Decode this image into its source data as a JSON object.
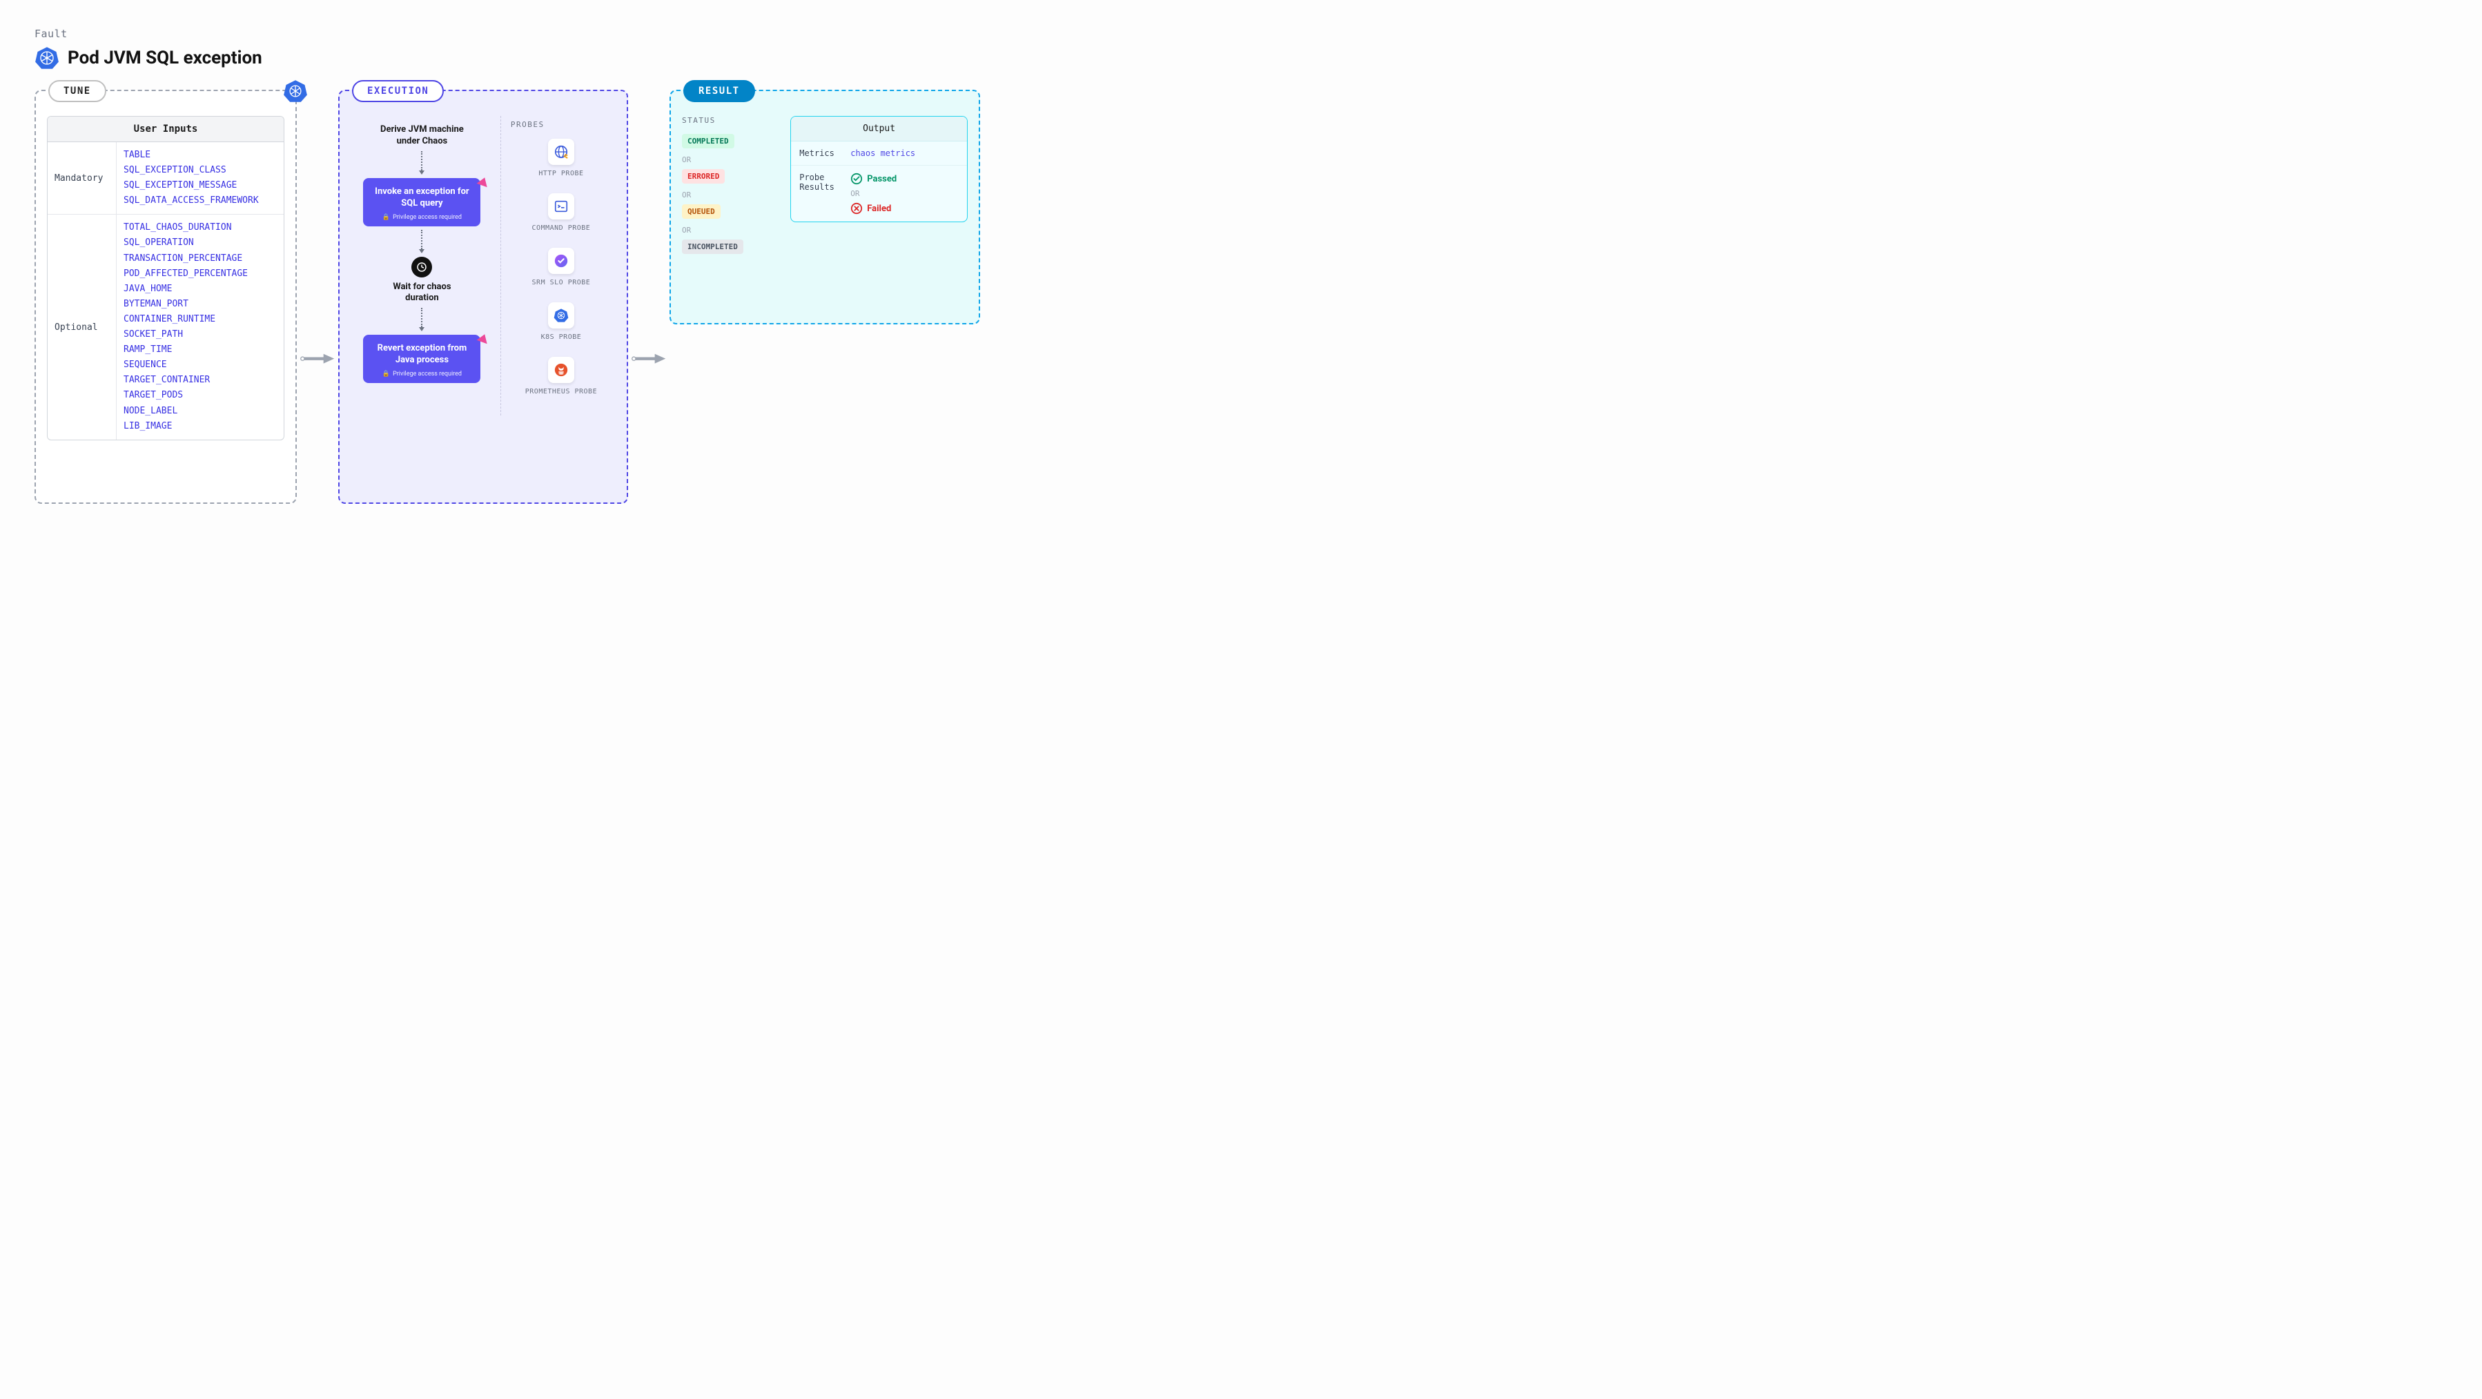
{
  "header": {
    "fault_label": "Fault",
    "title": "Pod JVM SQL exception"
  },
  "tune": {
    "pill": "TUNE",
    "card_title": "User Inputs",
    "mandatory_label": "Mandatory",
    "optional_label": "Optional",
    "mandatory": [
      "TABLE",
      "SQL_EXCEPTION_CLASS",
      "SQL_EXCEPTION_MESSAGE",
      "SQL_DATA_ACCESS_FRAMEWORK"
    ],
    "optional": [
      "TOTAL_CHAOS_DURATION",
      "SQL_OPERATION",
      "TRANSACTION_PERCENTAGE",
      "POD_AFFECTED_PERCENTAGE",
      "JAVA_HOME",
      "BYTEMAN_PORT",
      "CONTAINER_RUNTIME",
      "SOCKET_PATH",
      "RAMP_TIME",
      "SEQUENCE",
      "TARGET_CONTAINER",
      "TARGET_PODS",
      "NODE_LABEL",
      "LIB_IMAGE"
    ]
  },
  "execution": {
    "pill": "EXECUTION",
    "step1": "Derive JVM machine under Chaos",
    "step2_title": "Invoke an exception for SQL query",
    "step2_sub": "Privilege access required",
    "step3": "Wait for chaos duration",
    "step4_title": "Revert exception from Java process",
    "step4_sub": "Privilege access required",
    "probes_title": "PROBES",
    "probes": [
      "HTTP PROBE",
      "COMMAND PROBE",
      "SRM SLO PROBE",
      "K8S PROBE",
      "PROMETHEUS PROBE"
    ]
  },
  "result": {
    "pill": "RESULT",
    "status_title": "STATUS",
    "or": "OR",
    "statuses": {
      "completed": "COMPLETED",
      "errored": "ERRORED",
      "queued": "QUEUED",
      "incompleted": "INCOMPLETED"
    },
    "output_title": "Output",
    "metrics_label": "Metrics",
    "metrics_value": "chaos metrics",
    "probe_results_label": "Probe Results",
    "passed": "Passed",
    "failed": "Failed"
  }
}
